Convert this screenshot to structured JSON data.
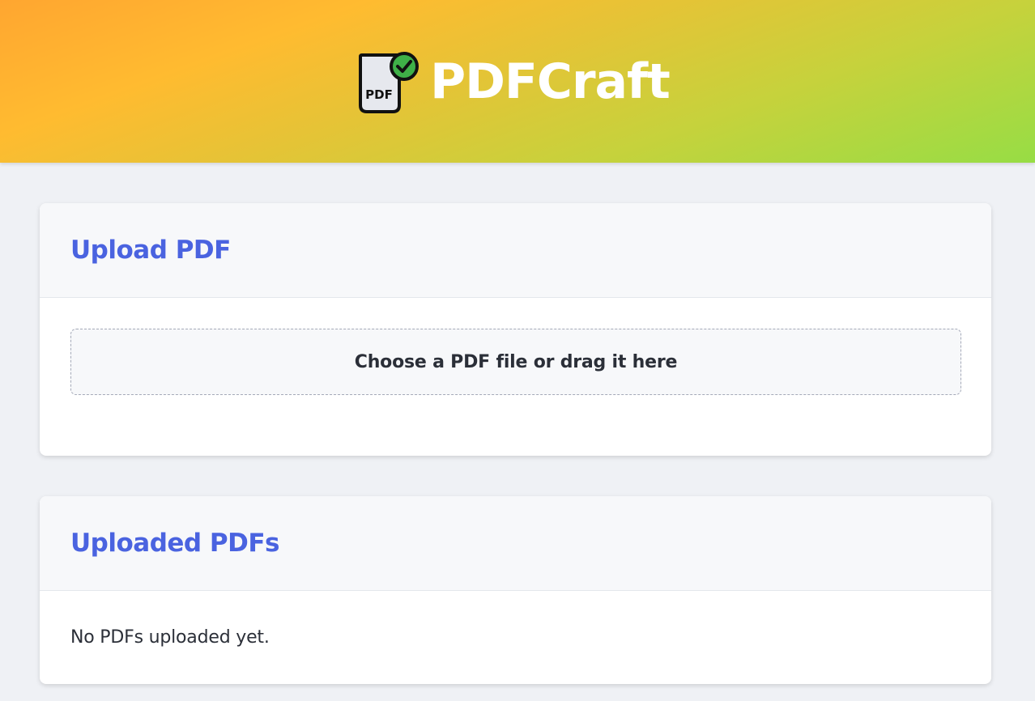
{
  "header": {
    "title": "PDFCraft",
    "logo": {
      "icon": "pdf-check-icon",
      "text": "PDF"
    }
  },
  "upload": {
    "title": "Upload PDF",
    "dropzone_label": "Choose a PDF file or drag it here"
  },
  "uploaded": {
    "title": "Uploaded PDFs",
    "empty_message": "No PDFs uploaded yet."
  },
  "colors": {
    "accent": "#4a63e0",
    "header_gradient_start": "#ffa630",
    "header_gradient_end": "#97dd45",
    "check_badge": "#3fb048",
    "background": "#eff1f5"
  }
}
